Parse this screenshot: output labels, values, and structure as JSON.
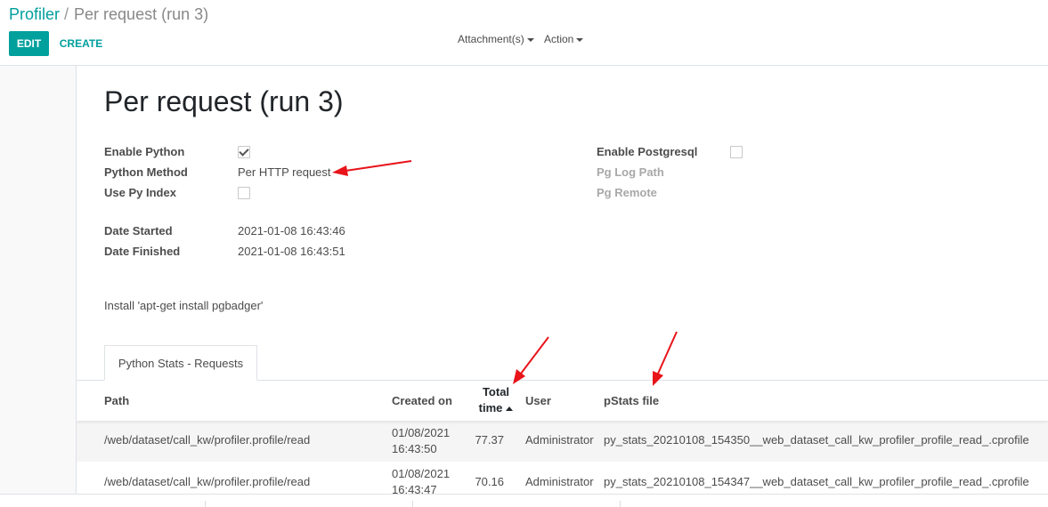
{
  "breadcrumb": {
    "parent": "Profiler",
    "separator": "/",
    "current": "Per request (run 3)"
  },
  "buttons": {
    "edit": "EDIT",
    "create": "CREATE"
  },
  "sidebar_menus": {
    "attachments": "Attachment(s)",
    "action": "Action"
  },
  "record": {
    "title": "Per request (run 3)",
    "fields": {
      "enable_python": {
        "label": "Enable Python",
        "checked": true
      },
      "python_method": {
        "label": "Python Method",
        "value": "Per HTTP request"
      },
      "use_py_index": {
        "label": "Use Py Index",
        "checked": false
      },
      "date_started": {
        "label": "Date Started",
        "value": "2021-01-08 16:43:46"
      },
      "date_finished": {
        "label": "Date Finished",
        "value": "2021-01-08 16:43:51"
      },
      "enable_postgresql": {
        "label": "Enable Postgresql",
        "checked": false
      },
      "pg_log_path": {
        "label": "Pg Log Path"
      },
      "pg_remote": {
        "label": "Pg Remote"
      }
    },
    "note": "Install 'apt-get install pgbadger'"
  },
  "tabs": [
    {
      "label": "Python Stats - Requests",
      "active": true
    }
  ],
  "table": {
    "columns": {
      "path": "Path",
      "created_on": "Created on",
      "total_time_1": "Total",
      "total_time_2": "time",
      "user": "User",
      "pstats_file": "pStats file"
    },
    "sort": {
      "column": "total_time",
      "direction": "ascending"
    },
    "rows": [
      {
        "path": "/web/dataset/call_kw/profiler.profile/read",
        "created_date": "01/08/2021",
        "created_time": "16:43:50",
        "total_time": "77.37",
        "user": "Administrator",
        "pstats_file": "py_stats_20210108_154350__web_dataset_call_kw_profiler_profile_read_.cprofile"
      },
      {
        "path": "/web/dataset/call_kw/profiler.profile/read",
        "created_date": "01/08/2021",
        "created_time": "16:43:47",
        "total_time": "70.16",
        "user": "Administrator",
        "pstats_file": "py_stats_20210108_154347__web_dataset_call_kw_profiler_profile_read_.cprofile"
      }
    ]
  },
  "colors": {
    "brand": "#00a09d",
    "annotation_arrow": "#e8141a"
  }
}
